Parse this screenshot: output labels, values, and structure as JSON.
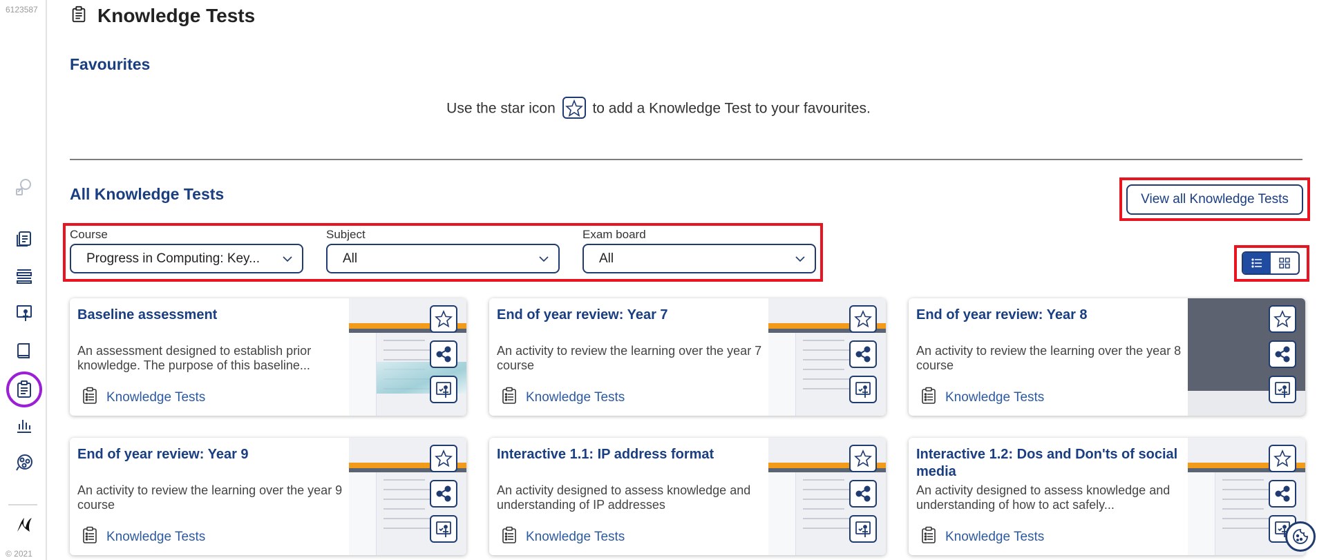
{
  "app": {
    "build_id": "6123587",
    "copyright": "© 2021"
  },
  "sidebar": {
    "items": [
      {
        "name": "search",
        "icon": "search-icon"
      },
      {
        "name": "resources",
        "icon": "documents-icon"
      },
      {
        "name": "lessons",
        "icon": "list-icon"
      },
      {
        "name": "teach",
        "icon": "presenter-icon"
      },
      {
        "name": "books",
        "icon": "book-icon"
      },
      {
        "name": "knowledge-tests",
        "icon": "clipboard-icon",
        "active": true
      },
      {
        "name": "reports",
        "icon": "bar-chart-icon"
      },
      {
        "name": "settings",
        "icon": "cog-group-icon"
      }
    ],
    "brand_icon": "kerboodle-logo"
  },
  "page": {
    "title": "Knowledge Tests"
  },
  "favourites": {
    "heading": "Favourites",
    "hint_before": "Use the star icon",
    "hint_after": "to add a Knowledge Test to your favourites."
  },
  "all_tests": {
    "heading": "All Knowledge Tests",
    "view_all_label": "View all Knowledge Tests",
    "filters": [
      {
        "label": "Course",
        "value": "Progress in Computing: Key..."
      },
      {
        "label": "Subject",
        "value": "All"
      },
      {
        "label": "Exam board",
        "value": "All"
      }
    ],
    "view_mode": "list"
  },
  "cards": [
    {
      "title": "Baseline assessment",
      "description": "An assessment designed to establish prior knowledge. The purpose of this baseline...",
      "tag": "Knowledge Tests",
      "thumb": "light-wave"
    },
    {
      "title": "End of year review: Year 7",
      "description": "An activity to review the learning over the year 7 course",
      "tag": "Knowledge Tests",
      "thumb": "light"
    },
    {
      "title": "End of year review: Year 8",
      "description": "An activity to review the learning over the year 8 course",
      "tag": "Knowledge Tests",
      "thumb": "dark"
    },
    {
      "title": "End of year review: Year 9",
      "description": "An activity to review the learning over the year 9 course",
      "tag": "Knowledge Tests",
      "thumb": "light"
    },
    {
      "title": "Interactive 1.1: IP address format",
      "description": "An activity designed to assess knowledge and understanding of IP addresses",
      "tag": "Knowledge Tests",
      "thumb": "light"
    },
    {
      "title": "Interactive 1.2: Dos and Don'ts of social media",
      "description": "An activity designed to assess knowledge and understanding of how to act safely...",
      "tag": "Knowledge Tests",
      "thumb": "light"
    }
  ],
  "colors": {
    "brand_blue": "#1a3e82",
    "highlight_red": "#e8141f",
    "active_purple": "#9c1fd8"
  }
}
